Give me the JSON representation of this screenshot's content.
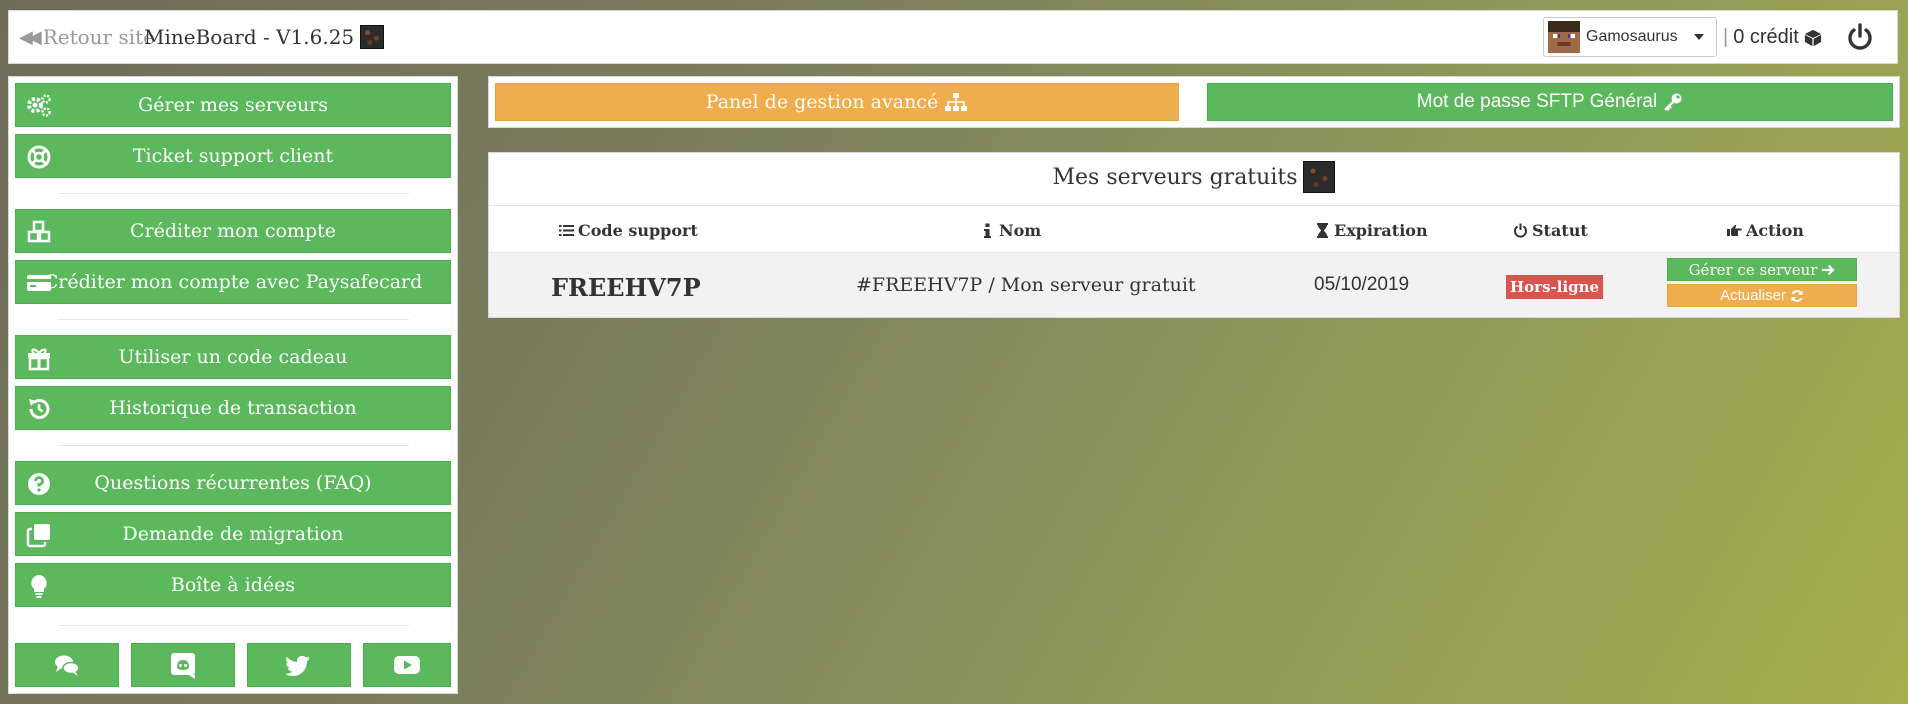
{
  "header": {
    "back_label": "Retour site",
    "brand": "MineBoard - V1.6.25",
    "username": "Gamosaurus",
    "credit": "0 crédit",
    "separator": "|"
  },
  "sidebar": {
    "items": [
      {
        "label": "Gérer mes serveurs",
        "icon": "gears-icon"
      },
      {
        "label": "Ticket support client",
        "icon": "life-ring-icon"
      },
      {
        "label": "Créditer mon compte",
        "icon": "cubes-icon"
      },
      {
        "label": "Créditer mon compte avec Paysafecard",
        "icon": "credit-card-icon"
      },
      {
        "label": "Utiliser un code cadeau",
        "icon": "gift-icon"
      },
      {
        "label": "Historique de transaction",
        "icon": "history-icon"
      },
      {
        "label": "Questions récurrentes (FAQ)",
        "icon": "question-circle-icon"
      },
      {
        "label": "Demande de migration",
        "icon": "clone-icon"
      },
      {
        "label": "Boîte à idées",
        "icon": "lightbulb-icon"
      }
    ],
    "social": [
      "comments-icon",
      "discord-icon",
      "twitter-icon",
      "youtube-icon"
    ]
  },
  "actions_bar": {
    "panel_label": "Panel de gestion avancé",
    "sftp_label": "Mot de passe SFTP Général"
  },
  "servers": {
    "title": "Mes serveurs gratuits",
    "columns": [
      "Code support",
      "Nom",
      "Expiration",
      "Statut",
      "Action"
    ],
    "rows": [
      {
        "code": "FREEHV7P",
        "name": "#FREEHV7P / Mon serveur gratuit",
        "expiration": "05/10/2019",
        "status": "Hors-ligne",
        "manage_label": "Gérer ce serveur",
        "refresh_label": "Actualiser"
      }
    ]
  },
  "colors": {
    "green": "#5cb85c",
    "orange": "#f0ad4e",
    "red": "#d9534f"
  }
}
